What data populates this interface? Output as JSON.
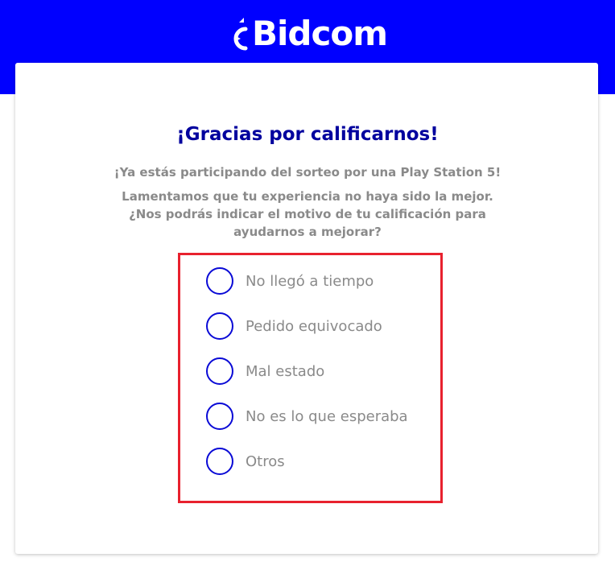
{
  "header": {
    "brand_name": "Bidcom",
    "logo_icon": "bidcom-logo-icon",
    "background_color": "#0000ff"
  },
  "survey": {
    "title": "¡Gracias por calificarnos!",
    "subtitle": "¡Ya estás participando del sorteo por una Play Station 5!",
    "question": "Lamentamos que tu experiencia no haya sido la mejor. ¿Nos podrás indicar el motivo de tu calificación para ayudarnos a mejorar?",
    "title_color": "#00009e",
    "options": [
      {
        "label": "No llegó a tiempo",
        "selected": false
      },
      {
        "label": "Pedido equivocado",
        "selected": false
      },
      {
        "label": "Mal estado",
        "selected": false
      },
      {
        "label": "No es lo que esperaba",
        "selected": false
      },
      {
        "label": "Otros",
        "selected": false
      }
    ],
    "highlight_color": "#e8212e",
    "radio_color": "#0a0ad6"
  }
}
